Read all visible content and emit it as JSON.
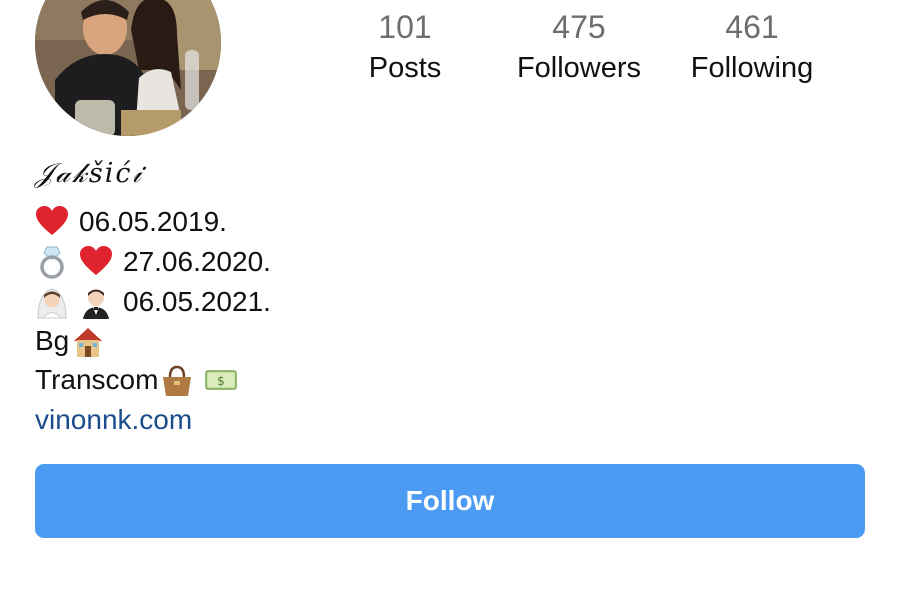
{
  "profile": {
    "name": "𝒥𝒶𝓀šić𝒾",
    "stats": [
      {
        "value": "101",
        "label": "Posts"
      },
      {
        "value": "475",
        "label": "Followers"
      },
      {
        "value": "461",
        "label": "Following"
      }
    ],
    "bio": [
      {
        "text": "06.05.2019.",
        "icons": [
          "red-heart-icon"
        ]
      },
      {
        "text": "27.06.2020.",
        "icons": [
          "ring-icon",
          "red-heart-icon"
        ]
      },
      {
        "text": "06.05.2021.",
        "icons": [
          "bride-icon",
          "groom-icon"
        ]
      },
      {
        "text": "Bg",
        "icons": [
          "house-icon"
        ]
      },
      {
        "text": "Transcom",
        "icons": [
          "handbag-icon",
          "money-icon"
        ]
      }
    ],
    "link": "vinonnk.com"
  },
  "actions": {
    "follow_label": "Follow"
  },
  "colors": {
    "follow_button": "#4c9bf2",
    "link": "#1b4d8c",
    "stat_number": "#6e6e6e"
  }
}
